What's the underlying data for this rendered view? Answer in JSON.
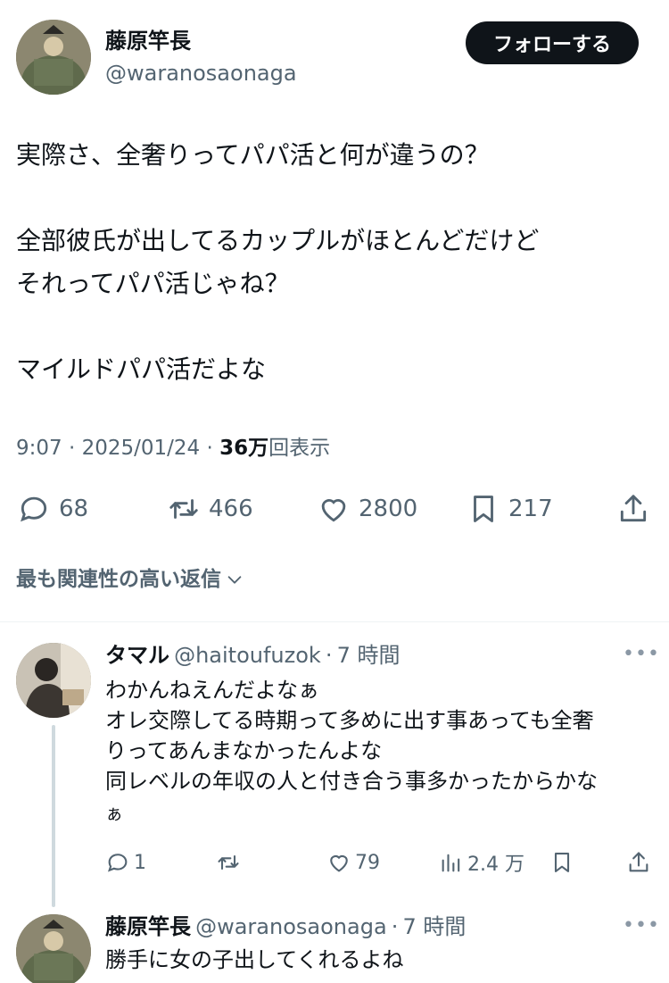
{
  "tweet": {
    "author": {
      "display_name": "藤原竿長",
      "handle": "@waranosaonaga",
      "avatar": "avatar-portrait"
    },
    "follow_label": "フォローする",
    "lines": [
      "実際さ、全奢りってパパ活と何が違うの？",
      "全部彼氏が出してるカップルがほとんどだけど",
      "それってパパ活じゃね？",
      "マイルドパパ活だよな"
    ],
    "meta": {
      "time": "9:07",
      "date": "2025/01/24",
      "views_value": "36万",
      "views_label": "回表示"
    },
    "actions": {
      "replies": "68",
      "retweets": "466",
      "likes": "2800",
      "bookmarks": "217"
    }
  },
  "sort_label": "最も関連性の高い返信",
  "replies": [
    {
      "display_name": "タマル",
      "handle": "@haitoufuzok",
      "time": "7 時間",
      "lines": [
        "わかんねえんだよなぁ",
        "オレ交際してる時期って多めに出す事あっても全奢",
        "りってあんまなかったんよな",
        "同レベルの年収の人と付き合う事多かったからかな",
        "ぁ"
      ],
      "stats": {
        "replies": "1",
        "likes": "79",
        "views": "2.4 万"
      },
      "more": "•••"
    },
    {
      "display_name": "藤原竿長",
      "handle": "@waranosaonaga",
      "time": "7 時間",
      "lines": [
        "勝手に女の子出してくれるよね"
      ],
      "more": "•••"
    }
  ],
  "sep": "·",
  "colors": {
    "text_primary": "#0f1419",
    "text_secondary": "#536471",
    "button_bg": "#0f1419",
    "divider": "#eff3f4",
    "thread_line": "#cfd9de"
  }
}
